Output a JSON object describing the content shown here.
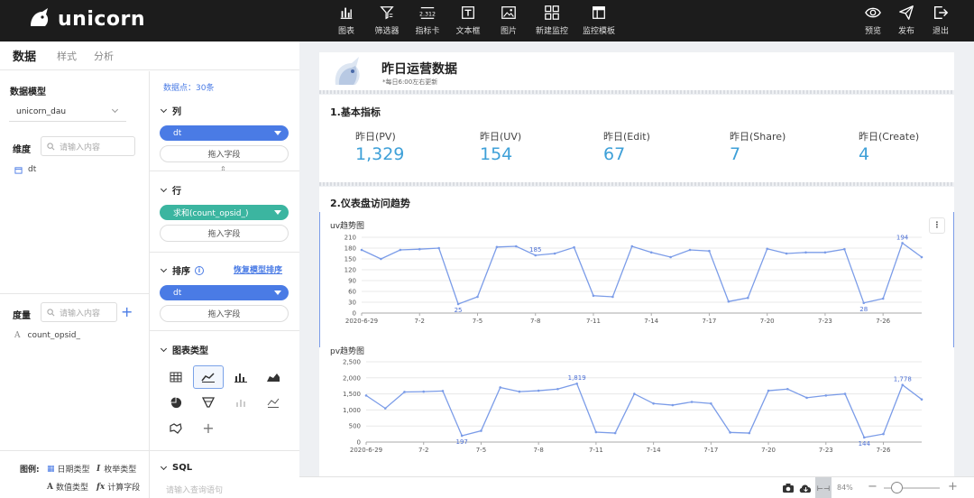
{
  "app": {
    "name": "unicorn"
  },
  "toolbar": {
    "center": [
      {
        "label": "图表",
        "icon": "bar-chart-icon"
      },
      {
        "label": "筛选器",
        "icon": "filter-icon"
      },
      {
        "label": "指标卡",
        "icon": "metric-card-icon"
      },
      {
        "label": "文本框",
        "icon": "textbox-icon"
      },
      {
        "label": "图片",
        "icon": "image-icon"
      },
      {
        "label": "新建监控",
        "icon": "monitor-icon"
      },
      {
        "label": "监控模板",
        "icon": "template-icon"
      }
    ],
    "right": [
      {
        "label": "预览",
        "icon": "eye-icon"
      },
      {
        "label": "发布",
        "icon": "send-icon"
      },
      {
        "label": "退出",
        "icon": "exit-icon"
      }
    ]
  },
  "left_panel": {
    "tabs": [
      "数据",
      "样式",
      "分析"
    ],
    "data_model_label": "数据模型",
    "data_model_value": "unicorn_dau",
    "dimension_label": "维度",
    "dimension_search_placeholder": "请输入内容",
    "dimensions": [
      "dt"
    ],
    "measure_label": "度量",
    "measure_search_placeholder": "请输入内容",
    "measures": [
      "count_opsid_"
    ],
    "legend_label": "图例:",
    "legend_items": [
      "日期类型",
      "枚举类型",
      "数值类型",
      "计算字段"
    ],
    "data_points": "数据点：30条",
    "columns": {
      "label": "列",
      "field": "dt",
      "drop": "拖入字段"
    },
    "rows": {
      "label": "行",
      "field": "求和(count_opsid_)",
      "drop": "拖入字段"
    },
    "sort": {
      "label": "排序",
      "restore": "恢复模型排序",
      "field": "dt",
      "drop": "拖入字段"
    },
    "chart_type_label": "图表类型",
    "sql": {
      "label": "SQL",
      "placeholder": "请输入查询语句"
    }
  },
  "colors": {
    "accent": "#4a7be5",
    "teal": "#3bb5a0",
    "metric": "#3ea0d8",
    "line": "#7b9ce8",
    "topbar": "#1c1c1c"
  },
  "dashboard": {
    "title": "昨日运营数据",
    "subtitle": "*每日6:00左右更新",
    "section1": "1.基本指标",
    "metrics": [
      {
        "label": "昨日(PV)",
        "value": "1,329"
      },
      {
        "label": "昨日(UV)",
        "value": "154"
      },
      {
        "label": "昨日(Edit)",
        "value": "67"
      },
      {
        "label": "昨日(Share)",
        "value": "7"
      },
      {
        "label": "昨日(Create)",
        "value": "4"
      }
    ],
    "section2": "2.仪表盘访问趋势"
  },
  "chart_data": [
    {
      "type": "line",
      "title": "uv趋势图",
      "x_tick_labels": [
        "2020-6-29",
        "7-2",
        "7-5",
        "7-8",
        "7-11",
        "7-14",
        "7-17",
        "7-20",
        "7-23",
        "7-26"
      ],
      "y_ticks": [
        0,
        30,
        60,
        90,
        120,
        150,
        180,
        210
      ],
      "ylim": [
        0,
        210
      ],
      "grid": true,
      "series": [
        {
          "values": [
            175,
            150,
            175,
            177,
            180,
            25,
            45,
            183,
            185,
            160,
            165,
            182,
            48,
            45,
            185,
            168,
            155,
            175,
            172,
            32,
            42,
            178,
            165,
            168,
            168,
            177,
            28,
            40,
            194,
            155
          ]
        }
      ],
      "data_labels": [
        {
          "index": 9,
          "text": "185"
        },
        {
          "index": 5,
          "text": "25"
        },
        {
          "index": 26,
          "text": "28"
        },
        {
          "index": 28,
          "text": "194"
        }
      ]
    },
    {
      "type": "line",
      "title": "pv趋势图",
      "x_tick_labels": [
        "2020-6-29",
        "7-2",
        "7-5",
        "7-8",
        "7-11",
        "7-14",
        "7-17",
        "7-20",
        "7-23",
        "7-26"
      ],
      "y_ticks": [
        0,
        500,
        1000,
        1500,
        2000,
        2500
      ],
      "y_tick_labels": [
        "0",
        "500",
        "1,000",
        "1,500",
        "2,000",
        "2,500"
      ],
      "ylim": [
        0,
        2500
      ],
      "grid": true,
      "series": [
        {
          "values": [
            1450,
            1050,
            1560,
            1570,
            1590,
            197,
            350,
            1700,
            1570,
            1600,
            1650,
            1819,
            310,
            280,
            1500,
            1200,
            1150,
            1250,
            1200,
            300,
            280,
            1600,
            1650,
            1380,
            1450,
            1500,
            144,
            250,
            1778,
            1329
          ]
        }
      ],
      "data_labels": [
        {
          "index": 11,
          "text": "1,819"
        },
        {
          "index": 5,
          "text": "197"
        },
        {
          "index": 26,
          "text": "144"
        },
        {
          "index": 28,
          "text": "1,778"
        }
      ]
    }
  ],
  "bottom": {
    "zoom": "84%"
  }
}
